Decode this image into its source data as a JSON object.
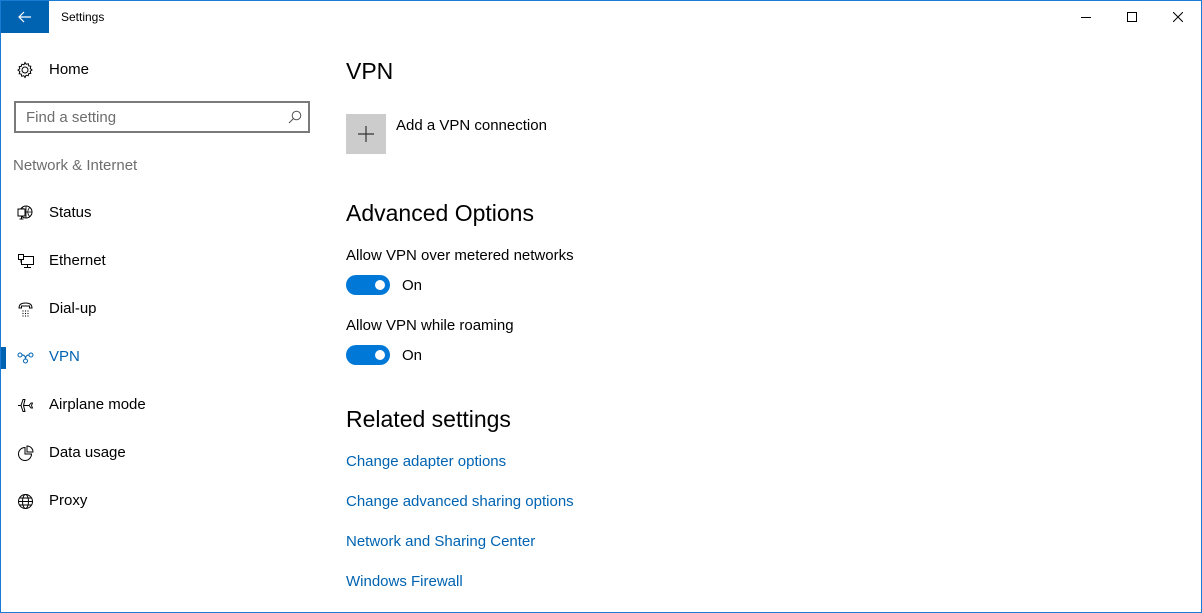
{
  "window": {
    "title": "Settings",
    "accent_color": "#0063b1",
    "border_color": "#1a7ad4",
    "caption_buttons": [
      "minimize",
      "maximize",
      "close"
    ]
  },
  "sidebar": {
    "home_label": "Home",
    "search_placeholder": "Find a setting",
    "search_value": "",
    "section_label": "Network & Internet",
    "items": [
      {
        "label": "Status",
        "icon": "status-globe-monitor-icon",
        "active": false
      },
      {
        "label": "Ethernet",
        "icon": "ethernet-icon",
        "active": false
      },
      {
        "label": "Dial-up",
        "icon": "dial-up-phone-icon",
        "active": false
      },
      {
        "label": "VPN",
        "icon": "vpn-icon",
        "active": true
      },
      {
        "label": "Airplane mode",
        "icon": "airplane-icon",
        "active": false
      },
      {
        "label": "Data usage",
        "icon": "data-usage-pie-icon",
        "active": false
      },
      {
        "label": "Proxy",
        "icon": "proxy-globe-icon",
        "active": false
      }
    ]
  },
  "main": {
    "title": "VPN",
    "add_vpn_label": "Add a VPN connection",
    "advanced": {
      "heading": "Advanced Options",
      "options": [
        {
          "label": "Allow VPN over metered networks",
          "state": "On",
          "enabled": true
        },
        {
          "label": "Allow VPN while roaming",
          "state": "On",
          "enabled": true
        }
      ]
    },
    "related": {
      "heading": "Related settings",
      "links": [
        "Change adapter options",
        "Change advanced sharing options",
        "Network and Sharing Center",
        "Windows Firewall"
      ]
    }
  }
}
